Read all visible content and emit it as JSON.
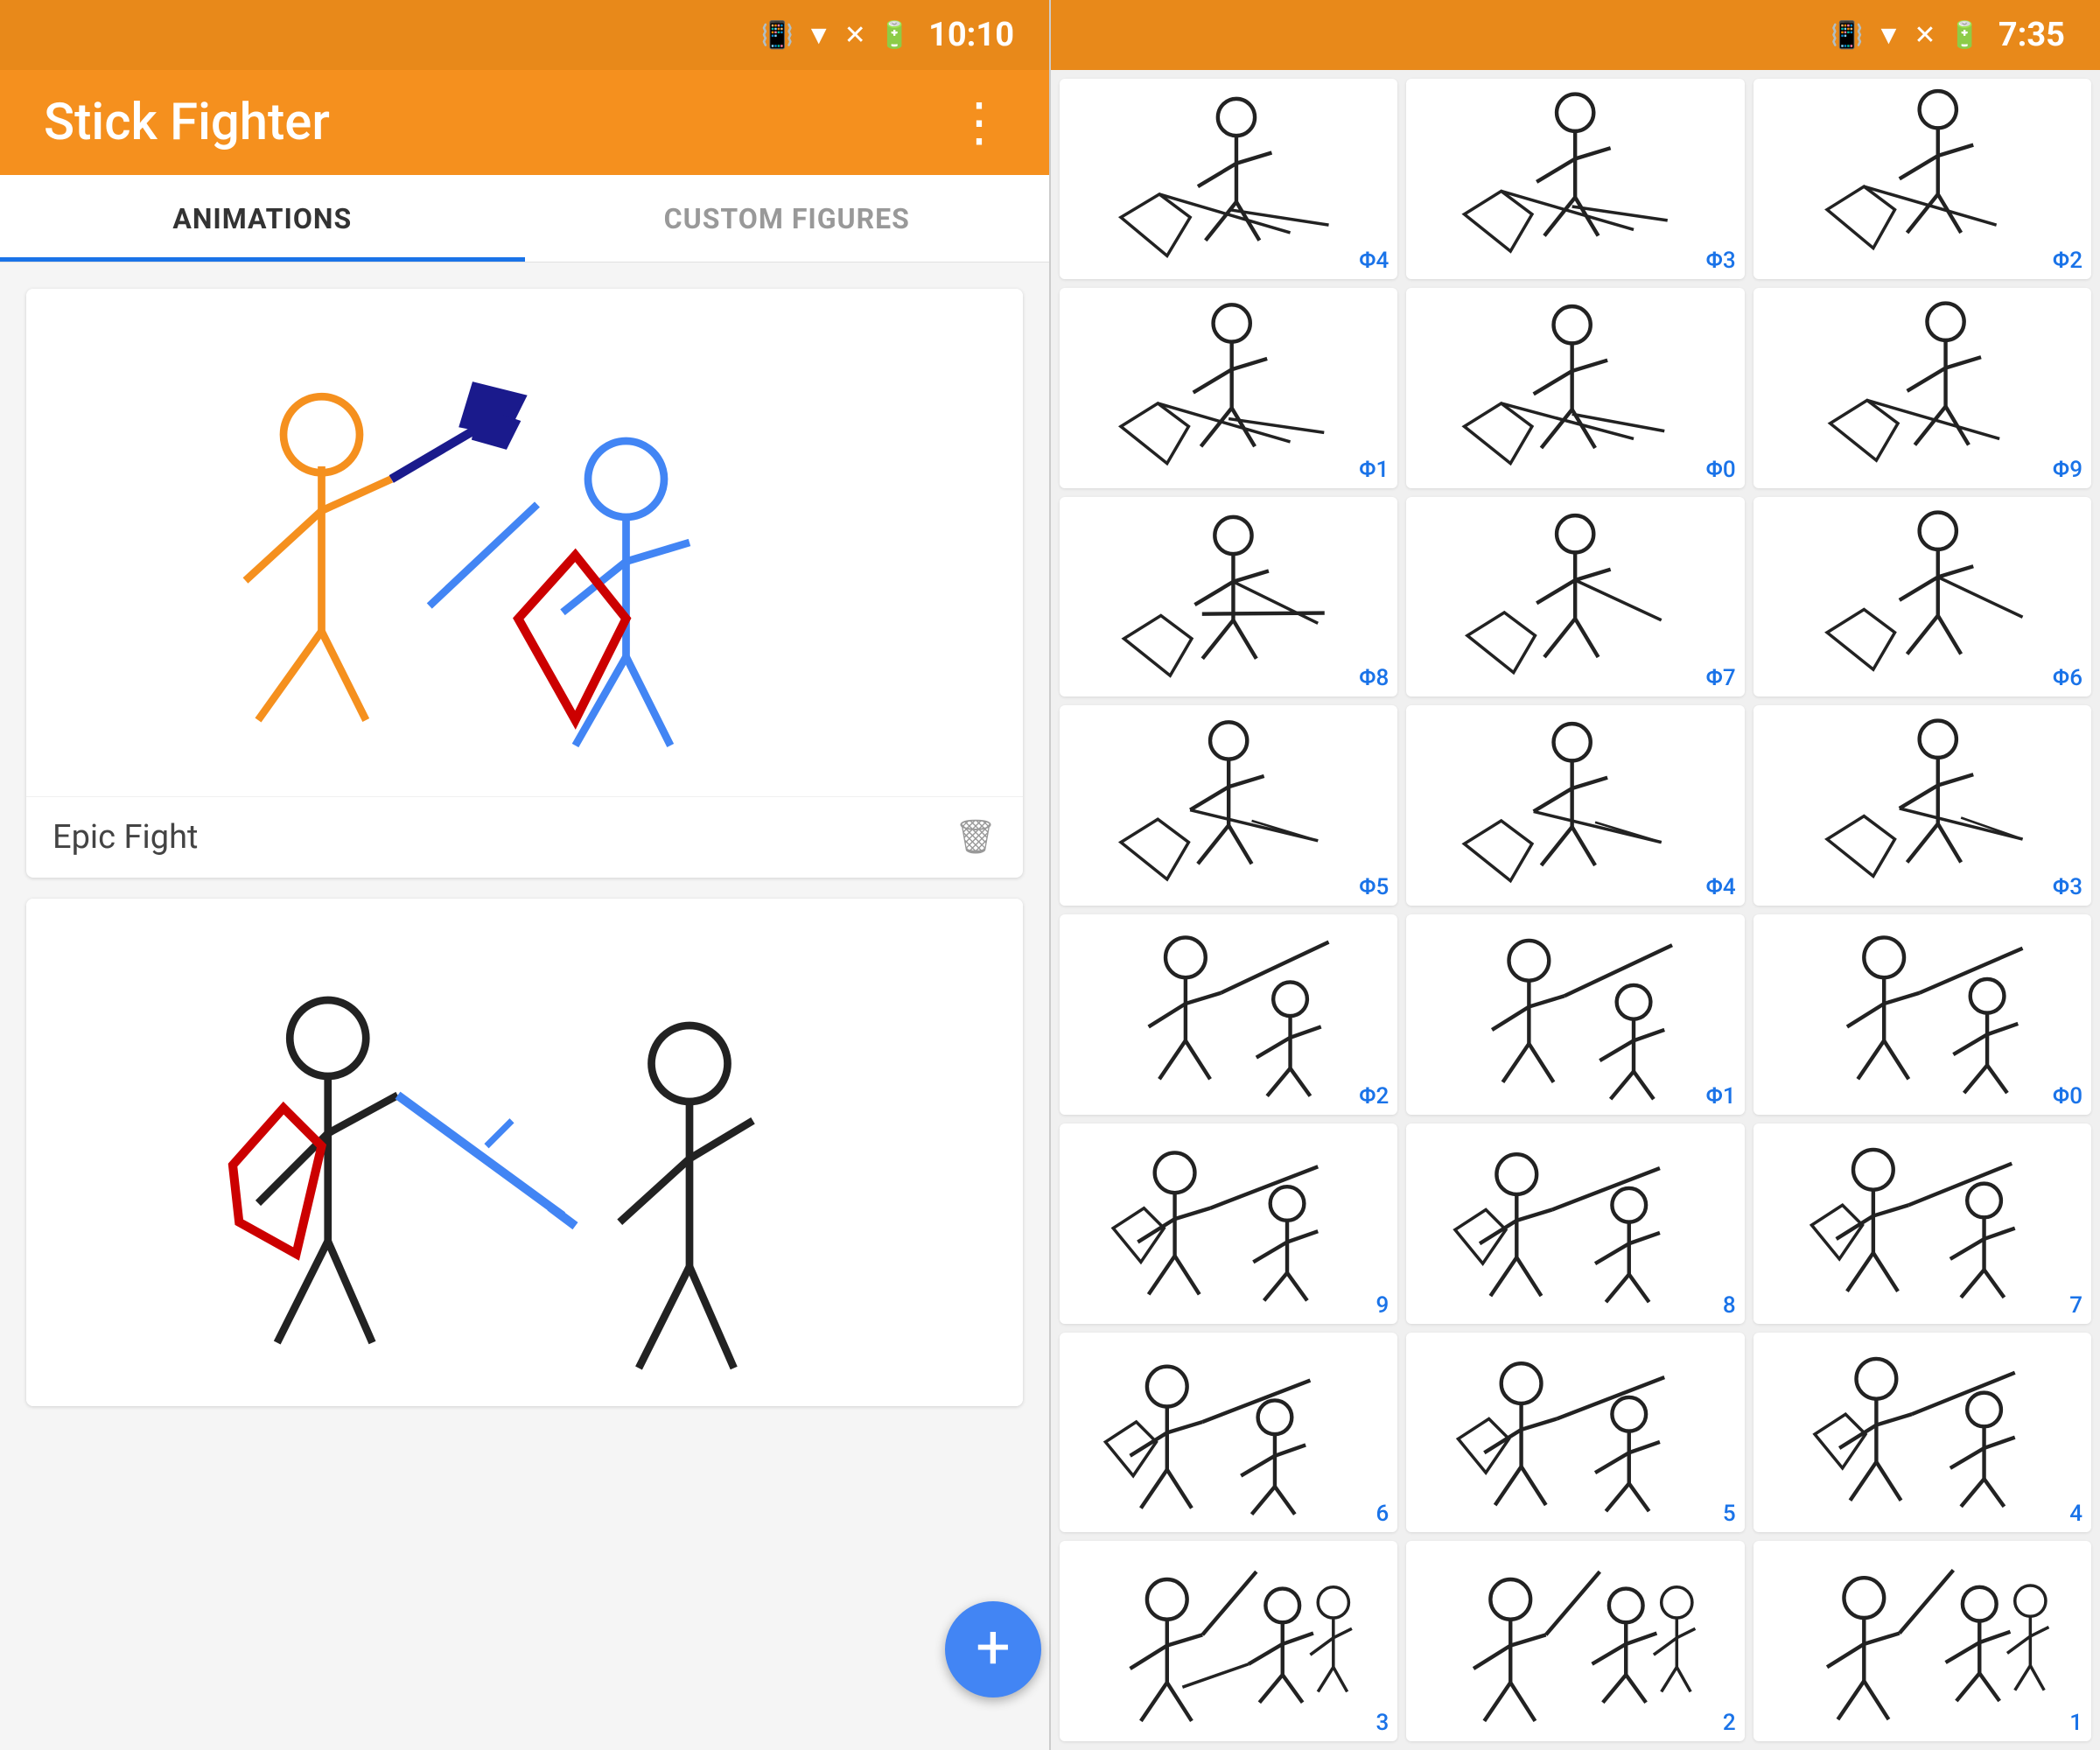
{
  "left": {
    "statusBar": {
      "time": "10:10"
    },
    "toolbar": {
      "title": "Stick Fighter",
      "menuIcon": "⋮"
    },
    "tabs": [
      {
        "id": "animations",
        "label": "ANIMATIONS",
        "active": true
      },
      {
        "id": "custom-figures",
        "label": "CUSTOM FIGURES",
        "active": false
      }
    ],
    "cards": [
      {
        "id": "epic-fight",
        "name": "Epic Fight"
      },
      {
        "id": "sword-fight",
        "name": ""
      }
    ],
    "fab": {
      "label": "+"
    }
  },
  "right": {
    "statusBar": {
      "time": "7:35"
    },
    "frames": [
      {
        "number": "Φ4"
      },
      {
        "number": "Φ3"
      },
      {
        "number": "Φ2"
      },
      {
        "number": "Φ1"
      },
      {
        "number": "Φ0"
      },
      {
        "number": "Φ9"
      },
      {
        "number": "Φ8"
      },
      {
        "number": "Φ7"
      },
      {
        "number": "Φ6"
      },
      {
        "number": "Φ5"
      },
      {
        "number": "Φ4"
      },
      {
        "number": "Φ3"
      },
      {
        "number": "Φ2"
      },
      {
        "number": "Φ1"
      },
      {
        "number": "Φ0"
      },
      {
        "number": "9"
      },
      {
        "number": "8"
      },
      {
        "number": "7"
      },
      {
        "number": "6"
      },
      {
        "number": "5"
      },
      {
        "number": "4"
      },
      {
        "number": "3"
      },
      {
        "number": "2"
      },
      {
        "number": "1"
      }
    ]
  }
}
